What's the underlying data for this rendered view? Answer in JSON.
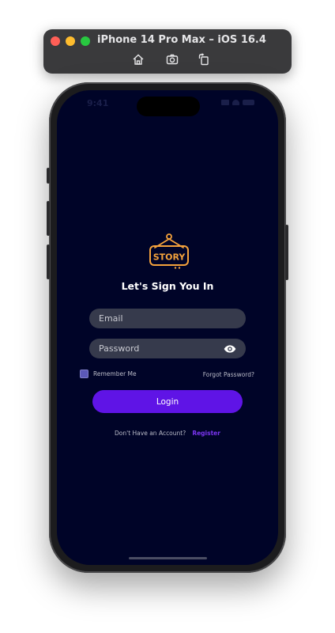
{
  "simulator": {
    "title": "iPhone 14 Pro Max – iOS 16.4",
    "icons": [
      "home-icon",
      "screenshot-icon",
      "rotate-icon"
    ]
  },
  "status_bar": {
    "time": "9:41"
  },
  "login": {
    "logo_text": "STORY",
    "heading": "Let's Sign You In",
    "email_placeholder": "Email",
    "password_placeholder": "Password",
    "remember_label": "Remember Me",
    "forgot_label": "Forgot Password?",
    "login_label": "Login",
    "register_prompt": "Don't Have an Account?",
    "register_label": "Register"
  },
  "colors": {
    "screen_bg": "#000428",
    "field_bg": "#363a4c",
    "primary": "#5f14e6",
    "logo_orange": "#f4a23c",
    "link": "#7a35f0"
  }
}
